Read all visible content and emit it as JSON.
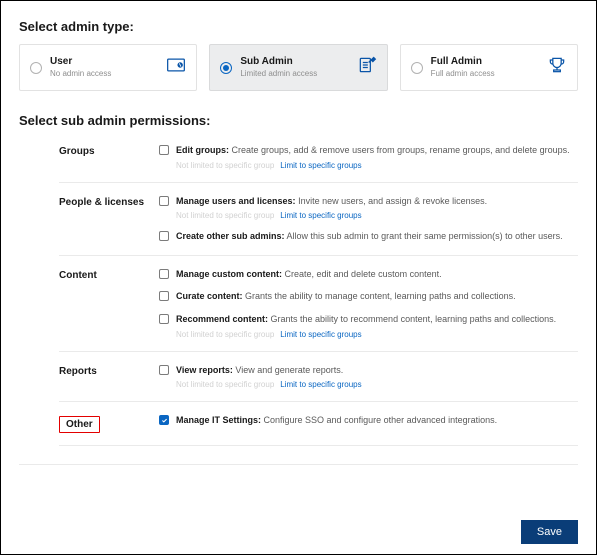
{
  "titles": {
    "admin_type": "Select admin type:",
    "permissions": "Select sub admin permissions:"
  },
  "cards": {
    "user": {
      "title": "User",
      "sub": "No admin access"
    },
    "sub": {
      "title": "Sub Admin",
      "sub": "Limited admin access"
    },
    "full": {
      "title": "Full Admin",
      "sub": "Full admin access"
    }
  },
  "limit": {
    "muted": "Not limited to specific group",
    "link": "Limit to specific groups"
  },
  "sections": {
    "groups": {
      "label": "Groups",
      "edit": {
        "title": "Edit groups:",
        "desc": " Create groups, add & remove users from groups, rename groups, and delete groups."
      }
    },
    "people": {
      "label": "People & licenses",
      "manage": {
        "title": "Manage users and licenses:",
        "desc": " Invite new users, and assign & revoke licenses."
      },
      "create": {
        "title": "Create other sub admins:",
        "desc": " Allow this sub admin to grant their same permission(s) to other users."
      }
    },
    "content": {
      "label": "Content",
      "manage_custom": {
        "title": "Manage custom content:",
        "desc": " Create, edit and delete custom content."
      },
      "curate": {
        "title": "Curate content:",
        "desc": " Grants the ability to manage content, learning paths and collections."
      },
      "recommend": {
        "title": "Recommend content:",
        "desc": " Grants the ability to recommend content, learning paths and collections."
      }
    },
    "reports": {
      "label": "Reports",
      "view": {
        "title": "View reports:",
        "desc": " View and generate reports."
      }
    },
    "other": {
      "label": "Other",
      "it": {
        "title": "Manage IT Settings:",
        "desc": " Configure SSO and configure other advanced integrations."
      }
    }
  },
  "buttons": {
    "save": "Save"
  }
}
